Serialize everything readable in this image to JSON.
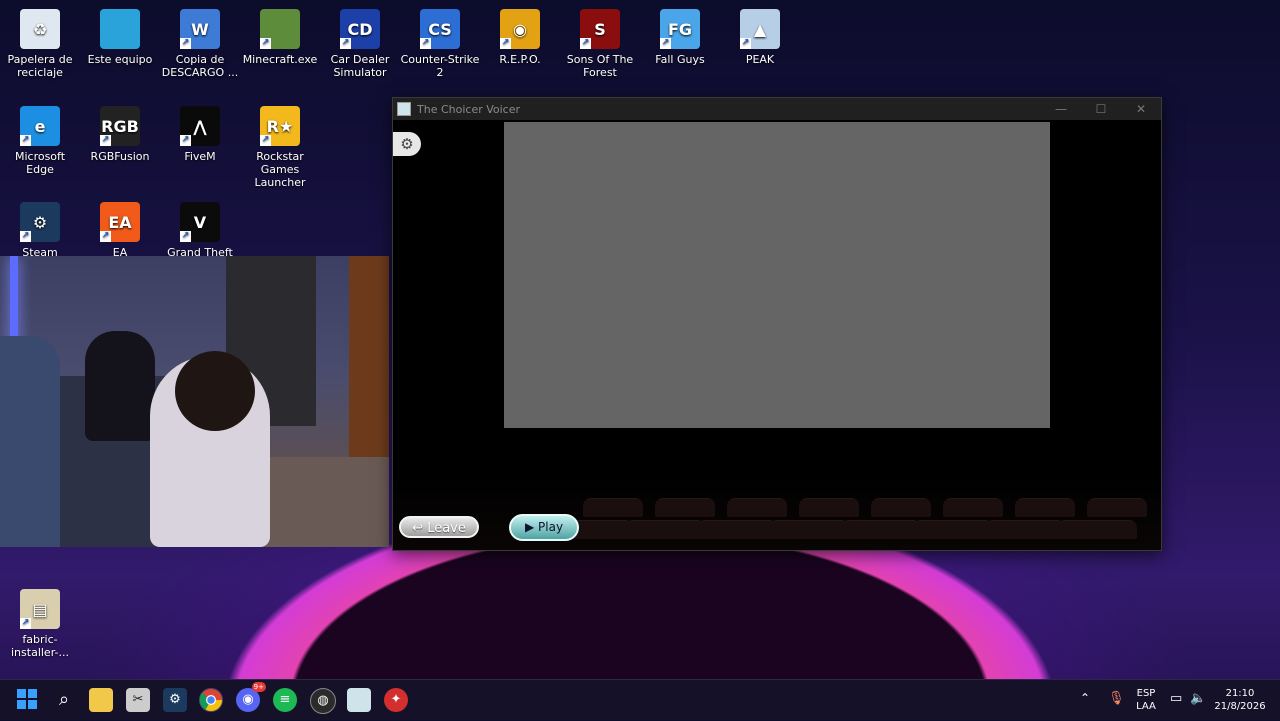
{
  "desktop": {
    "icons": [
      {
        "label": "Papelera de reciclaje",
        "icon": "recycle-bin-icon",
        "color": "#dfe8f0",
        "glyph": "♻"
      },
      {
        "label": "Este equipo",
        "icon": "computer-icon",
        "color": "#29a3d9",
        "glyph": ""
      },
      {
        "label": "Copia de DESCARGO ...",
        "icon": "word-document-icon",
        "color": "#3d7bd6",
        "glyph": "W"
      },
      {
        "label": "Minecraft.exe",
        "icon": "minecraft-icon",
        "color": "#5d8d3a",
        "glyph": ""
      },
      {
        "label": "Car Dealer Simulator",
        "icon": "car-dealer-icon",
        "color": "#1d3fa8",
        "glyph": "CD"
      },
      {
        "label": "Counter-Strike 2",
        "icon": "counter-strike-icon",
        "color": "#2c6ed3",
        "glyph": "CS"
      },
      {
        "label": "R.E.P.O.",
        "icon": "repo-icon",
        "color": "#e2a214",
        "glyph": "◉"
      },
      {
        "label": "Sons Of The Forest",
        "icon": "sons-of-the-forest-icon",
        "color": "#8a0e0e",
        "glyph": "S"
      },
      {
        "label": "Fall Guys",
        "icon": "fall-guys-icon",
        "color": "#4aa6e9",
        "glyph": "FG"
      },
      {
        "label": "PEAK",
        "icon": "peak-icon",
        "color": "#b6cfe6",
        "glyph": "▲"
      },
      {
        "label": "Microsoft Edge",
        "icon": "edge-icon",
        "color": "#1d8fe3",
        "glyph": "e"
      },
      {
        "label": "RGBFusion",
        "icon": "rgbfusion-icon",
        "color": "#222",
        "glyph": "RGB"
      },
      {
        "label": "FiveM",
        "icon": "fivem-icon",
        "color": "#0a0a0a",
        "glyph": "⋀"
      },
      {
        "label": "Rockstar Games Launcher",
        "icon": "rockstar-icon",
        "color": "#f3b81b",
        "glyph": "R★"
      },
      {
        "label": "Steam",
        "icon": "steam-icon",
        "color": "#1c3a5e",
        "glyph": "⚙"
      },
      {
        "label": "EA",
        "icon": "ea-icon",
        "color": "#f25a19",
        "glyph": "EA"
      },
      {
        "label": "Grand Theft Auto",
        "icon": "gta-icon",
        "color": "#0b0b0b",
        "glyph": "V"
      },
      {
        "label": "fabric-installer-...",
        "icon": "fabric-installer-icon",
        "color": "#d9cfae",
        "glyph": "▤"
      }
    ]
  },
  "window": {
    "title": "The Choicer Voicer",
    "minimize": "—",
    "maximize": "☐",
    "close": "✕",
    "settings_glyph": "⚙",
    "leave_label": "Leave",
    "leave_glyph": "↩",
    "play_label": "Play",
    "play_glyph": "▶"
  },
  "taskbar": {
    "language": "ESP",
    "layout": "LAA",
    "time": "21:10",
    "date": "21/8/2026",
    "discord_badge": "9+"
  }
}
